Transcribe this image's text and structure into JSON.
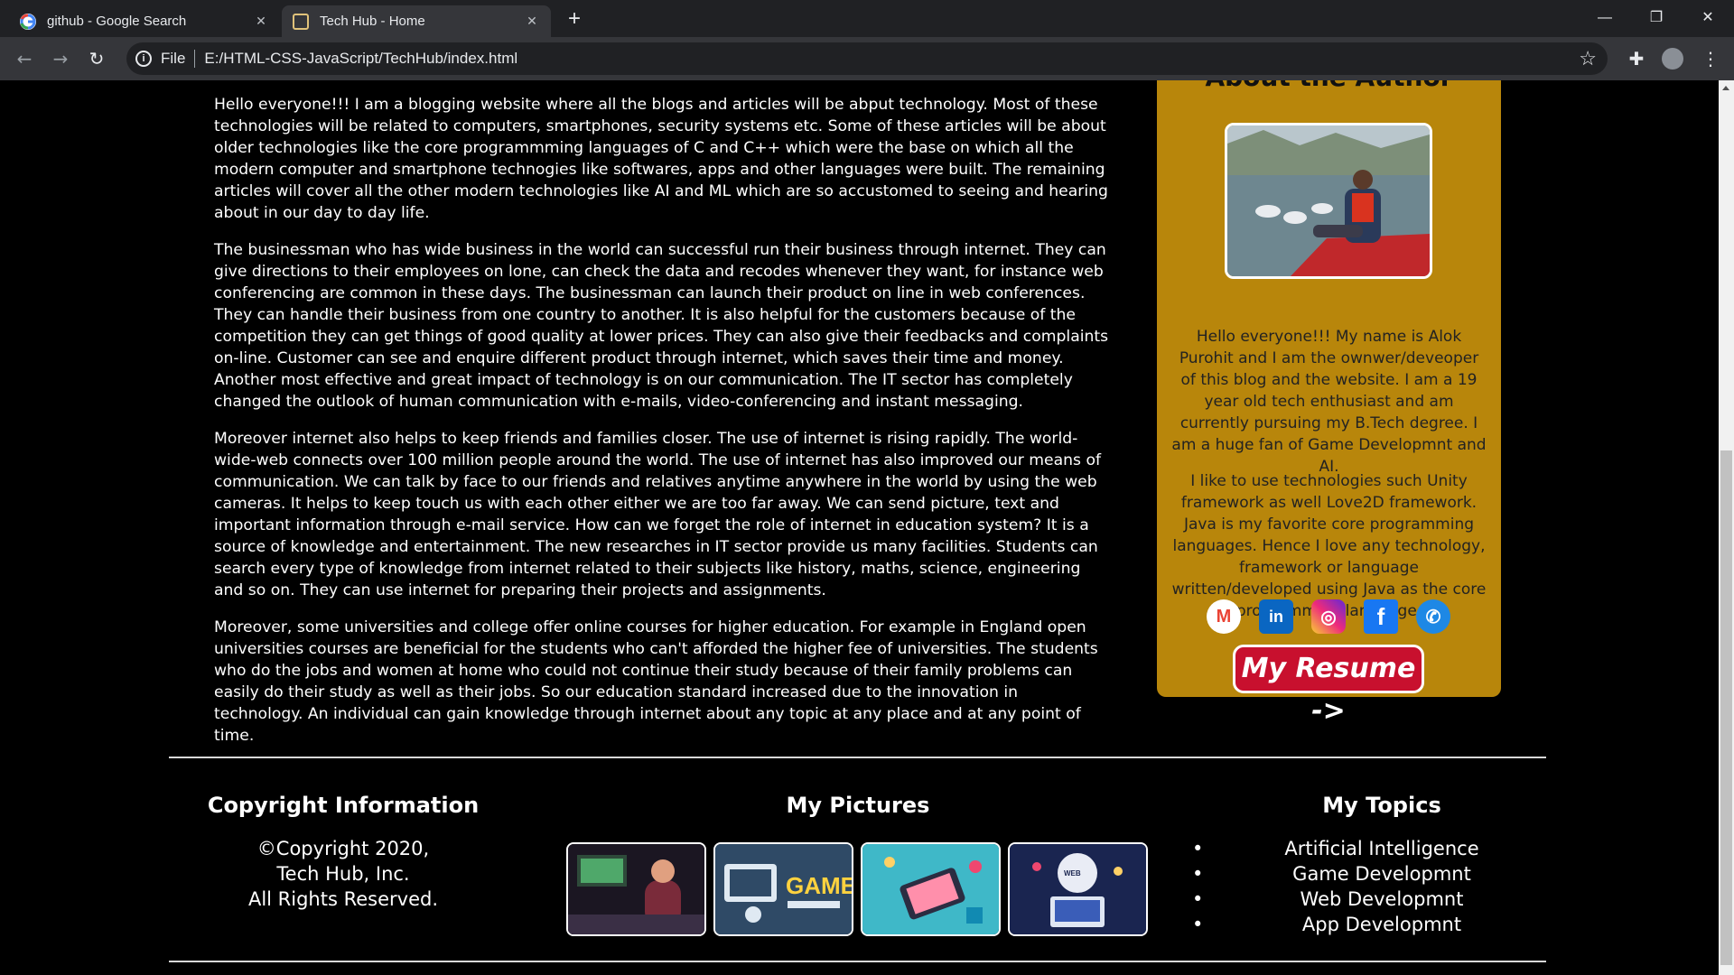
{
  "browser": {
    "tabs": [
      {
        "title": "github - Google Search",
        "active": false,
        "favicon": "google-icon"
      },
      {
        "title": "Tech Hub - Home",
        "active": true,
        "favicon": "techhub-icon"
      }
    ],
    "new_tab": "+",
    "window_controls": {
      "minimize": "—",
      "restore": "❐",
      "close": "✕"
    },
    "nav": {
      "back": "←",
      "forward": "→",
      "reload": "↻"
    },
    "address": {
      "scheme_label": "File",
      "url": "E:/HTML-CSS-JavaScript/TechHub/index.html"
    }
  },
  "article": {
    "paragraphs": [
      "Hello everyone!!! I am a blogging website where all the blogs and articles will be abput technology. Most of these technologies will be related to computers, smartphones, security systems etc. Some of these articles will be about older technologies like the core programmming languages of C and C++ which were the base on which all the modern computer and smartphone technogies like softwares, apps and other languages were built. The remaining articles will cover all the other modern technologies like AI and ML which are so accustomed to seeing and hearing about in our day to day life.",
      "The businessman who has wide business in the world can successful run their business through internet. They can give directions to their employees on lone, can check the data and recodes whenever they want, for instance web conferencing are common in these days. The businessman can launch their product on line in web conferences. They can handle their business from one country to another. It is also helpful for the customers because of the competition they can get things of good quality at lower prices. They can also give their feedbacks and complaints on-line. Customer can see and enquire different product through internet, which saves their time and money. Another most effective and great impact of technology is on our communication. The IT sector has completely changed the outlook of human communication with e-mails, video-conferencing and instant messaging.",
      "Moreover internet also helps to keep friends and families closer. The use of internet is rising rapidly. The world-wide-web connects over 100 million people around the world. The use of internet has also improved our means of communication. We can talk by face to our friends and relatives anytime anywhere in the world by using the web cameras. It helps to keep touch us with each other either we are too far away. We can send picture, text and important information through e-mail service. How can we forget the role of internet in education system? It is a source of knowledge and entertainment. The new researches in IT sector provide us many facilities. Students can search every type of knowledge from internet related to their subjects like history, maths, science, engineering and so on. They can use internet for preparing their projects and assignments.",
      "Moreover, some universities and college offer online courses for higher education. For example in England open universities courses are beneficial for the students who can't afforded the higher fee of universities. The students who do the jobs and women at home who could not continue their study because of their family problems can easily do their study as well as their jobs. So our education standard increased due to the innovation in technology. An individual can gain knowledge through internet about any topic at any place and at any point of time."
    ]
  },
  "author": {
    "heading": "About the Author",
    "bio": "Hello everyone!!! My name is Alok Purohit and I am the ownwer/deveoper of this blog and the website. I am a 19 year old tech enthusiast and am currently pursuing my B.Tech degree. I am a huge fan of Game Developmnt and AI.",
    "interests": "I like to use technologies such Unity framework as well Love2D framework. Java is my favorite core programming languages. Hence I love any technology, framework or language written/developed using Java as the core programming language.",
    "social": [
      {
        "name": "gmail-icon",
        "glyph": "M",
        "color": "#ffffff",
        "fg": "#ea4335"
      },
      {
        "name": "linkedin-icon",
        "glyph": "in",
        "color": "#0a66c2",
        "fg": "#ffffff"
      },
      {
        "name": "instagram-icon",
        "glyph": "◎",
        "color": "#d6249f",
        "fg": "#ffffff"
      },
      {
        "name": "facebook-icon",
        "glyph": "f",
        "color": "#1877f2",
        "fg": "#ffffff"
      },
      {
        "name": "phone-icon",
        "glyph": "✆",
        "color": "#1e88e5",
        "fg": "#ffffff"
      }
    ],
    "resume_button": "My Resume ->"
  },
  "footer": {
    "copyright": {
      "heading": "Copyright Information",
      "lines": [
        "©Copyright 2020,",
        "Tech Hub, Inc.",
        "All Rights Reserved."
      ]
    },
    "pictures": {
      "heading": "My Pictures"
    },
    "topics": {
      "heading": "My Topics",
      "items": [
        "Artificial Intelligence",
        "Game Developmnt",
        "Web Developmnt",
        "App Developmnt"
      ]
    }
  },
  "colors": {
    "aside_bg": "#b8860b",
    "resume_bg": "#c8102e",
    "page_bg": "#000000"
  }
}
